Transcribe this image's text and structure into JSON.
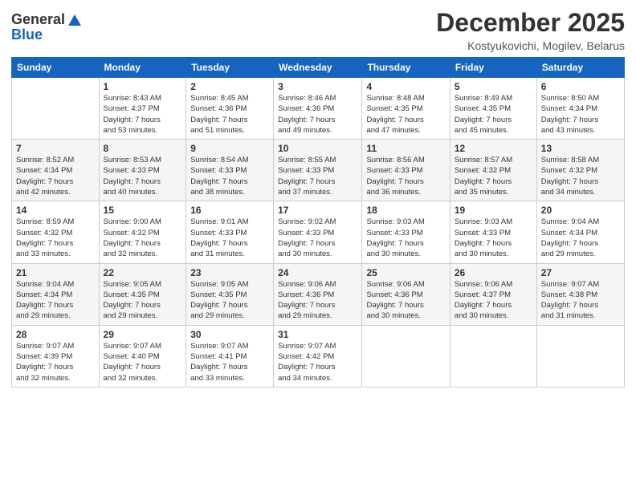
{
  "header": {
    "logo": {
      "line1": "General",
      "line2": "Blue"
    },
    "title": "December 2025",
    "subtitle": "Kostyukovichi, Mogilev, Belarus"
  },
  "calendar": {
    "days_of_week": [
      "Sunday",
      "Monday",
      "Tuesday",
      "Wednesday",
      "Thursday",
      "Friday",
      "Saturday"
    ],
    "weeks": [
      [
        {
          "day": "",
          "info": ""
        },
        {
          "day": "1",
          "info": "Sunrise: 8:43 AM\nSunset: 4:37 PM\nDaylight: 7 hours\nand 53 minutes."
        },
        {
          "day": "2",
          "info": "Sunrise: 8:45 AM\nSunset: 4:36 PM\nDaylight: 7 hours\nand 51 minutes."
        },
        {
          "day": "3",
          "info": "Sunrise: 8:46 AM\nSunset: 4:36 PM\nDaylight: 7 hours\nand 49 minutes."
        },
        {
          "day": "4",
          "info": "Sunrise: 8:48 AM\nSunset: 4:35 PM\nDaylight: 7 hours\nand 47 minutes."
        },
        {
          "day": "5",
          "info": "Sunrise: 8:49 AM\nSunset: 4:35 PM\nDaylight: 7 hours\nand 45 minutes."
        },
        {
          "day": "6",
          "info": "Sunrise: 8:50 AM\nSunset: 4:34 PM\nDaylight: 7 hours\nand 43 minutes."
        }
      ],
      [
        {
          "day": "7",
          "info": "Sunrise: 8:52 AM\nSunset: 4:34 PM\nDaylight: 7 hours\nand 42 minutes."
        },
        {
          "day": "8",
          "info": "Sunrise: 8:53 AM\nSunset: 4:33 PM\nDaylight: 7 hours\nand 40 minutes."
        },
        {
          "day": "9",
          "info": "Sunrise: 8:54 AM\nSunset: 4:33 PM\nDaylight: 7 hours\nand 38 minutes."
        },
        {
          "day": "10",
          "info": "Sunrise: 8:55 AM\nSunset: 4:33 PM\nDaylight: 7 hours\nand 37 minutes."
        },
        {
          "day": "11",
          "info": "Sunrise: 8:56 AM\nSunset: 4:33 PM\nDaylight: 7 hours\nand 36 minutes."
        },
        {
          "day": "12",
          "info": "Sunrise: 8:57 AM\nSunset: 4:32 PM\nDaylight: 7 hours\nand 35 minutes."
        },
        {
          "day": "13",
          "info": "Sunrise: 8:58 AM\nSunset: 4:32 PM\nDaylight: 7 hours\nand 34 minutes."
        }
      ],
      [
        {
          "day": "14",
          "info": "Sunrise: 8:59 AM\nSunset: 4:32 PM\nDaylight: 7 hours\nand 33 minutes."
        },
        {
          "day": "15",
          "info": "Sunrise: 9:00 AM\nSunset: 4:32 PM\nDaylight: 7 hours\nand 32 minutes."
        },
        {
          "day": "16",
          "info": "Sunrise: 9:01 AM\nSunset: 4:33 PM\nDaylight: 7 hours\nand 31 minutes."
        },
        {
          "day": "17",
          "info": "Sunrise: 9:02 AM\nSunset: 4:33 PM\nDaylight: 7 hours\nand 30 minutes."
        },
        {
          "day": "18",
          "info": "Sunrise: 9:03 AM\nSunset: 4:33 PM\nDaylight: 7 hours\nand 30 minutes."
        },
        {
          "day": "19",
          "info": "Sunrise: 9:03 AM\nSunset: 4:33 PM\nDaylight: 7 hours\nand 30 minutes."
        },
        {
          "day": "20",
          "info": "Sunrise: 9:04 AM\nSunset: 4:34 PM\nDaylight: 7 hours\nand 29 minutes."
        }
      ],
      [
        {
          "day": "21",
          "info": "Sunrise: 9:04 AM\nSunset: 4:34 PM\nDaylight: 7 hours\nand 29 minutes."
        },
        {
          "day": "22",
          "info": "Sunrise: 9:05 AM\nSunset: 4:35 PM\nDaylight: 7 hours\nand 29 minutes."
        },
        {
          "day": "23",
          "info": "Sunrise: 9:05 AM\nSunset: 4:35 PM\nDaylight: 7 hours\nand 29 minutes."
        },
        {
          "day": "24",
          "info": "Sunrise: 9:06 AM\nSunset: 4:36 PM\nDaylight: 7 hours\nand 29 minutes."
        },
        {
          "day": "25",
          "info": "Sunrise: 9:06 AM\nSunset: 4:36 PM\nDaylight: 7 hours\nand 30 minutes."
        },
        {
          "day": "26",
          "info": "Sunrise: 9:06 AM\nSunset: 4:37 PM\nDaylight: 7 hours\nand 30 minutes."
        },
        {
          "day": "27",
          "info": "Sunrise: 9:07 AM\nSunset: 4:38 PM\nDaylight: 7 hours\nand 31 minutes."
        }
      ],
      [
        {
          "day": "28",
          "info": "Sunrise: 9:07 AM\nSunset: 4:39 PM\nDaylight: 7 hours\nand 32 minutes."
        },
        {
          "day": "29",
          "info": "Sunrise: 9:07 AM\nSunset: 4:40 PM\nDaylight: 7 hours\nand 32 minutes."
        },
        {
          "day": "30",
          "info": "Sunrise: 9:07 AM\nSunset: 4:41 PM\nDaylight: 7 hours\nand 33 minutes."
        },
        {
          "day": "31",
          "info": "Sunrise: 9:07 AM\nSunset: 4:42 PM\nDaylight: 7 hours\nand 34 minutes."
        },
        {
          "day": "",
          "info": ""
        },
        {
          "day": "",
          "info": ""
        },
        {
          "day": "",
          "info": ""
        }
      ]
    ]
  }
}
